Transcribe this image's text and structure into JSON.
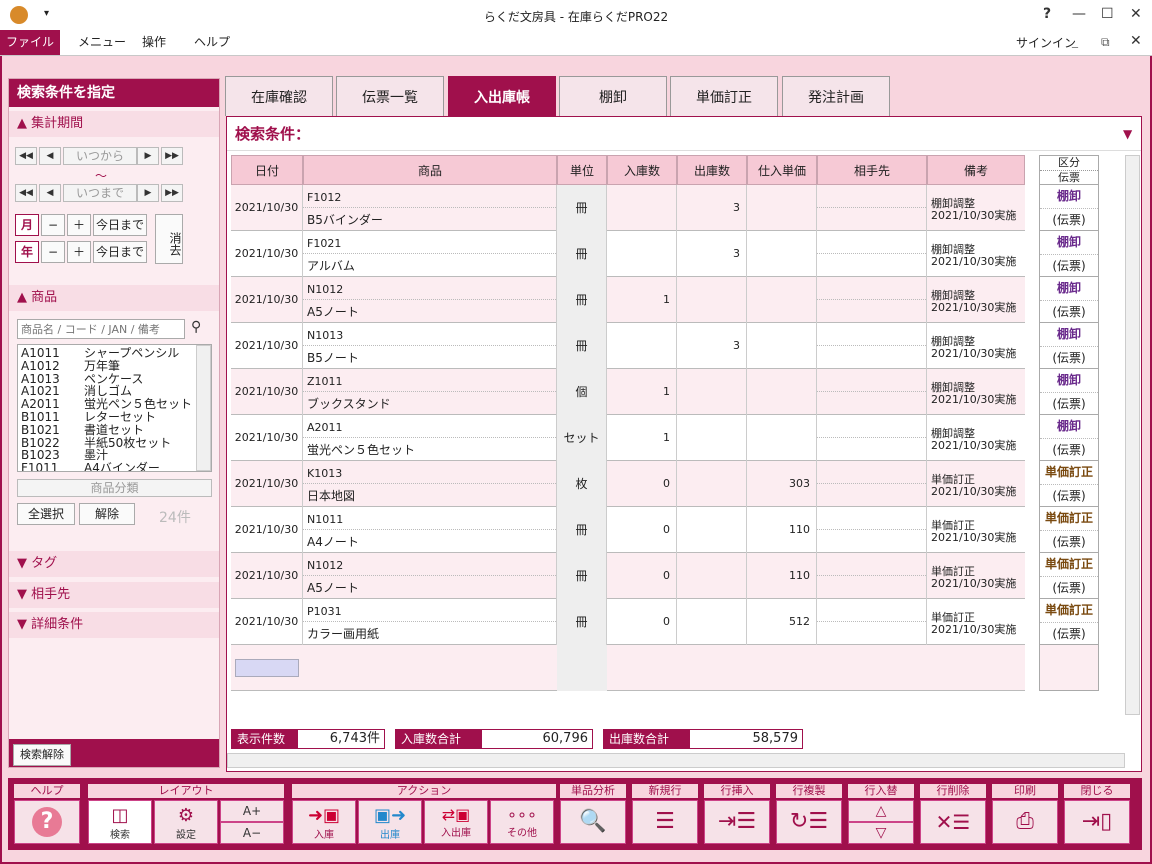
{
  "window": {
    "title": "らくだ文房具 - 在庫らくだPRO22",
    "help": "?",
    "minimize": "—",
    "maximize": "☐",
    "close": "✕"
  },
  "menu": {
    "items": [
      "ファイル",
      "メニュー",
      "操作",
      "ヘルプ"
    ],
    "signin": "サインイン"
  },
  "left": {
    "header": "検索条件を指定",
    "period": {
      "label": "集計期間",
      "from": "いつから",
      "tilde": "～",
      "to": "いつまで",
      "month": "月",
      "year": "年",
      "minus": "−",
      "plus": "＋",
      "today": "今日まで",
      "clear": "消去"
    },
    "product": {
      "label": "商品",
      "search_placeholder": "商品名 / コード / JAN / 備考",
      "items": [
        [
          "A1011",
          "シャープペンシル"
        ],
        [
          "A1012",
          "万年筆"
        ],
        [
          "A1013",
          "ペンケース"
        ],
        [
          "A1021",
          "消しゴム"
        ],
        [
          "A2011",
          "蛍光ペン５色セット"
        ],
        [
          "B1011",
          "レターセット"
        ],
        [
          "B1021",
          "書道セット"
        ],
        [
          "B1022",
          "半紙50枚セット"
        ],
        [
          "B1023",
          "墨汁"
        ],
        [
          "F1011",
          "A4バインダー"
        ]
      ],
      "category": "商品分類",
      "select_all": "全選択",
      "release": "解除",
      "count": "24件"
    },
    "tag": "タグ",
    "partner": "相手先",
    "detail": "詳細条件",
    "clear_search": "検索解除"
  },
  "tabs": [
    "在庫確認",
    "伝票一覧",
    "入出庫帳",
    "棚卸",
    "単価訂正",
    "発注計画"
  ],
  "active_tab": 2,
  "main": {
    "cond_label": "検索条件：",
    "headers": {
      "date": "日付",
      "product": "商品",
      "unit": "単位",
      "in": "入庫数",
      "out": "出庫数",
      "price": "仕入単価",
      "partner": "相手先",
      "note": "備考",
      "kubun1": "区分",
      "kubun2": "伝票"
    },
    "rows": [
      {
        "date": "2021/10/30",
        "code": "F1012",
        "name": "B5バインダー",
        "unit": "冊",
        "in": "",
        "out": "3",
        "price": "",
        "partner": "",
        "note1": "棚卸調整",
        "note2": "2021/10/30実施",
        "k1": "棚卸",
        "k2": "(伝票)"
      },
      {
        "date": "2021/10/30",
        "code": "F1021",
        "name": "アルバム",
        "unit": "冊",
        "in": "",
        "out": "3",
        "price": "",
        "partner": "",
        "note1": "棚卸調整",
        "note2": "2021/10/30実施",
        "k1": "棚卸",
        "k2": "(伝票)"
      },
      {
        "date": "2021/10/30",
        "code": "N1012",
        "name": "A5ノート",
        "unit": "冊",
        "in": "1",
        "out": "",
        "price": "",
        "partner": "",
        "note1": "棚卸調整",
        "note2": "2021/10/30実施",
        "k1": "棚卸",
        "k2": "(伝票)"
      },
      {
        "date": "2021/10/30",
        "code": "N1013",
        "name": "B5ノート",
        "unit": "冊",
        "in": "",
        "out": "3",
        "price": "",
        "partner": "",
        "note1": "棚卸調整",
        "note2": "2021/10/30実施",
        "k1": "棚卸",
        "k2": "(伝票)"
      },
      {
        "date": "2021/10/30",
        "code": "Z1011",
        "name": "ブックスタンド",
        "unit": "個",
        "in": "1",
        "out": "",
        "price": "",
        "partner": "",
        "note1": "棚卸調整",
        "note2": "2021/10/30実施",
        "k1": "棚卸",
        "k2": "(伝票)"
      },
      {
        "date": "2021/10/30",
        "code": "A2011",
        "name": "蛍光ペン５色セット",
        "unit": "セット",
        "in": "1",
        "out": "",
        "price": "",
        "partner": "",
        "note1": "棚卸調整",
        "note2": "2021/10/30実施",
        "k1": "棚卸",
        "k2": "(伝票)"
      },
      {
        "date": "2021/10/30",
        "code": "K1013",
        "name": "日本地図",
        "unit": "枚",
        "in": "0",
        "out": "",
        "price": "303",
        "partner": "",
        "note1": "単価訂正",
        "note2": "2021/10/30実施",
        "k1": "単価訂正",
        "k2": "(伝票)"
      },
      {
        "date": "2021/10/30",
        "code": "N1011",
        "name": "A4ノート",
        "unit": "冊",
        "in": "0",
        "out": "",
        "price": "110",
        "partner": "",
        "note1": "単価訂正",
        "note2": "2021/10/30実施",
        "k1": "単価訂正",
        "k2": "(伝票)"
      },
      {
        "date": "2021/10/30",
        "code": "N1012",
        "name": "A5ノート",
        "unit": "冊",
        "in": "0",
        "out": "",
        "price": "110",
        "partner": "",
        "note1": "単価訂正",
        "note2": "2021/10/30実施",
        "k1": "単価訂正",
        "k2": "(伝票)"
      },
      {
        "date": "2021/10/30",
        "code": "P1031",
        "name": "カラー画用紙",
        "unit": "冊",
        "in": "0",
        "out": "",
        "price": "512",
        "partner": "",
        "note1": "単価訂正",
        "note2": "2021/10/30実施",
        "k1": "単価訂正",
        "k2": "(伝票)"
      }
    ],
    "summary": {
      "count_label": "表示件数",
      "count": "6,743件",
      "in_label": "入庫数合計",
      "in_total": "60,796",
      "out_label": "出庫数合計",
      "out_total": "58,579"
    }
  },
  "bottom": {
    "groups": [
      "ヘルプ",
      "レイアウト",
      "アクション",
      "単品分析",
      "新規行",
      "行挿入",
      "行複製",
      "行入替",
      "行削除",
      "印刷",
      "閉じる"
    ],
    "layout": {
      "search": "検索",
      "settings": "設定",
      "font_up": "A+",
      "font_down": "A−"
    },
    "action": {
      "in": "入庫",
      "out": "出庫",
      "inout": "入出庫",
      "other": "その他"
    }
  },
  "colors": {
    "accent": "#a0104c",
    "tanaoroshi": "#6a2a8c",
    "tanka": "#7a4a10"
  }
}
